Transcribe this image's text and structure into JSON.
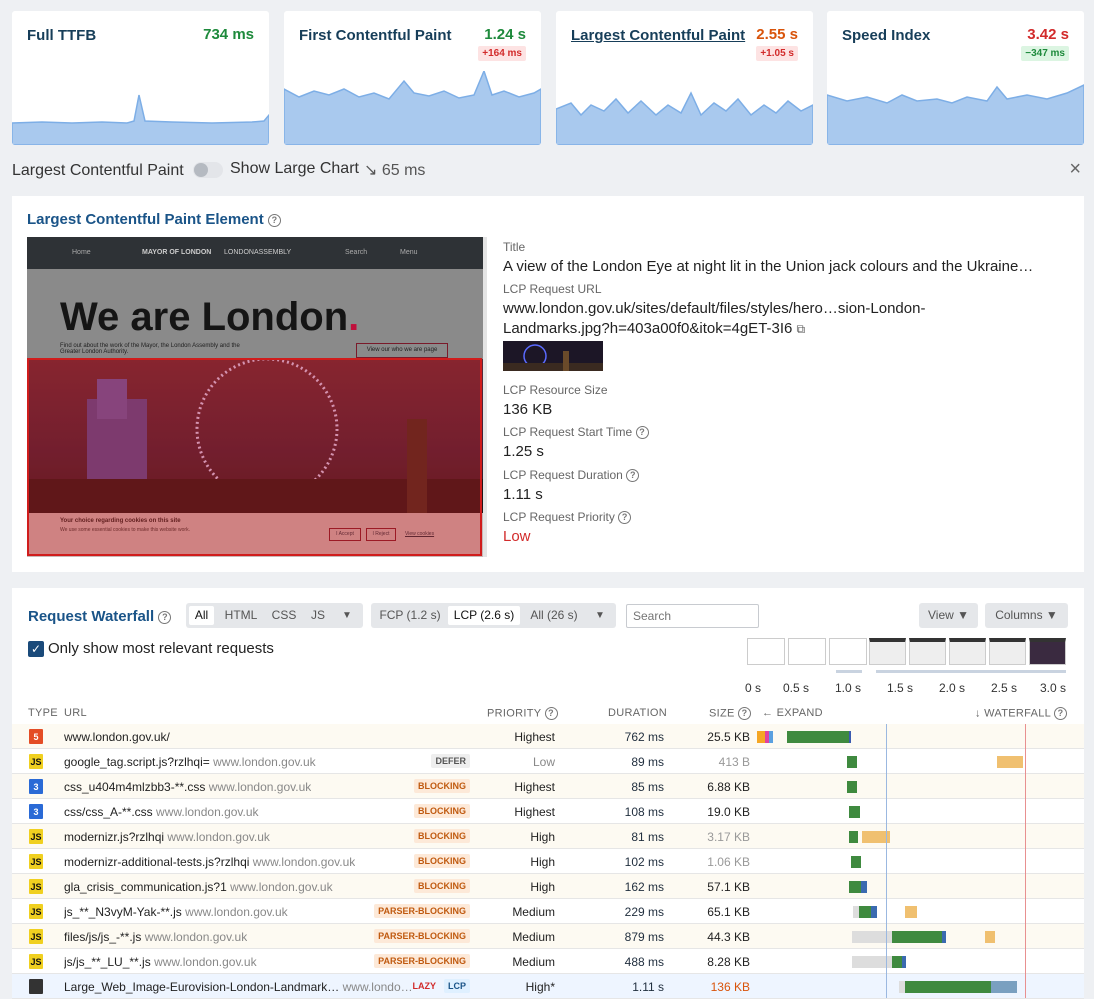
{
  "metrics": [
    {
      "name": "Full TTFB",
      "value": "734 ms",
      "value_color": "#1e8a3c",
      "delta": ""
    },
    {
      "name": "First Contentful Paint",
      "value": "1.24 s",
      "value_color": "#1e8a3c",
      "delta": "+164 ms",
      "delta_kind": "bad"
    },
    {
      "name": "Largest Contentful Paint",
      "value": "2.55 s",
      "value_color": "#d9540b",
      "delta": "+1.05 s",
      "delta_kind": "bad"
    },
    {
      "name": "Speed Index",
      "value": "3.42 s",
      "value_color": "#d22b2b",
      "delta": "−347 ms",
      "delta_kind": "good"
    }
  ],
  "chart_bar": {
    "title": "Largest Contentful Paint",
    "toggle_label": "Show Large Chart",
    "trend": "↘ 65 ms",
    "close": "×"
  },
  "lcp": {
    "heading": "Largest Contentful Paint Element",
    "screenshot": {
      "nav_home": "Home",
      "nav_brand": "MAYOR OF LONDON",
      "nav_brand2": "LONDONASSEMBLY",
      "nav_search": "Search",
      "nav_menu": "Menu",
      "hero": "We are London",
      "hero_dot": ".",
      "intro": "Find out about the work of the Mayor, the London Assembly and the Greater London Authority.",
      "cta": "View our who we are page",
      "cookie_title": "Your choice regarding cookies on this site",
      "cookie_text": "We use some essential cookies to make this website work.",
      "cookie_accept": "I Accept",
      "cookie_reject": "I Reject",
      "cookie_view": "View cookies"
    },
    "title_label": "Title",
    "title_value": "A view of the London Eye at night lit in the Union jack colours and the Ukraine…",
    "url_label": "LCP Request URL",
    "url_value1": "www.london.gov.uk/sites/default/files/styles/hero…sion-London-",
    "url_value2": "Landmarks.jpg?h=403a00f0&itok=4gET-3I6",
    "size_label": "LCP Resource Size",
    "size_value": "136 KB",
    "start_label": "LCP Request Start Time",
    "start_value": "1.25 s",
    "dur_label": "LCP Request Duration",
    "dur_value": "1.11 s",
    "prio_label": "LCP Request Priority",
    "prio_value": "Low"
  },
  "waterfall": {
    "heading": "Request Waterfall",
    "types": [
      "All",
      "HTML",
      "CSS",
      "JS"
    ],
    "ranges": [
      "FCP (1.2 s)",
      "LCP (2.6 s)",
      "All (26 s)"
    ],
    "search_placeholder": "Search",
    "view_label": "View ▼",
    "columns_label": "Columns ▼",
    "relevant_label": "Only show most relevant requests",
    "timeline_ticks": [
      "0 s",
      "0.5 s",
      "1.0 s",
      "1.5 s",
      "2.0 s",
      "2.5 s",
      "3.0 s"
    ],
    "col_type": "TYPE",
    "col_url": "URL",
    "col_priority": "PRIORITY",
    "col_duration": "DURATION",
    "col_size": "SIZE",
    "col_expand": "← EXPAND",
    "col_waterfall": "↓ WATERFALL",
    "rows": [
      {
        "type": "html",
        "url": "www.london.gov.uk/",
        "host": "",
        "tag": "",
        "priority": "Highest",
        "duration": "762 ms",
        "size": "25.5 KB",
        "size_dim": false
      },
      {
        "type": "js",
        "url": "google_tag.script.js?rzlhqi=",
        "host": "www.london.gov.uk",
        "tag": "DEFER",
        "priority": "Low",
        "duration": "89 ms",
        "size": "413 B",
        "size_dim": true
      },
      {
        "type": "css",
        "url": "css_u404m4mlzbb3-**.css",
        "host": "www.london.gov.uk",
        "tag": "BLOCKING",
        "priority": "Highest",
        "duration": "85 ms",
        "size": "6.88 KB",
        "size_dim": false
      },
      {
        "type": "css",
        "url": "css/css_A-**.css",
        "host": "www.london.gov.uk",
        "tag": "BLOCKING",
        "priority": "Highest",
        "duration": "108 ms",
        "size": "19.0 KB",
        "size_dim": false
      },
      {
        "type": "js",
        "url": "modernizr.js?rzlhqi",
        "host": "www.london.gov.uk",
        "tag": "BLOCKING",
        "priority": "High",
        "duration": "81 ms",
        "size": "3.17 KB",
        "size_dim": true
      },
      {
        "type": "js",
        "url": "modernizr-additional-tests.js?rzlhqi",
        "host": "www.london.gov.uk",
        "tag": "BLOCKING",
        "priority": "High",
        "duration": "102 ms",
        "size": "1.06 KB",
        "size_dim": true
      },
      {
        "type": "js",
        "url": "gla_crisis_communication.js?1",
        "host": "www.london.gov.uk",
        "tag": "BLOCKING",
        "priority": "High",
        "duration": "162 ms",
        "size": "57.1 KB",
        "size_dim": false
      },
      {
        "type": "js",
        "url": "js_**_N3vyM-Yak-**.js",
        "host": "www.london.gov.uk",
        "tag": "PARSER-BLOCKING",
        "priority": "Medium",
        "duration": "229 ms",
        "size": "65.1 KB",
        "size_dim": false
      },
      {
        "type": "js",
        "url": "files/js/js_-**.js",
        "host": "www.london.gov.uk",
        "tag": "PARSER-BLOCKING",
        "priority": "Medium",
        "duration": "879 ms",
        "size": "44.3 KB",
        "size_dim": false
      },
      {
        "type": "js",
        "url": "js/js_**_LU_**.js",
        "host": "www.london.gov.uk",
        "tag": "PARSER-BLOCKING",
        "priority": "Medium",
        "duration": "488 ms",
        "size": "8.28 KB",
        "size_dim": false
      },
      {
        "type": "img",
        "url": "Large_Web_Image-Eurovision-London-Landmark…",
        "host": "www.londo…",
        "tag": "LAZY",
        "tag2": "LCP",
        "priority": "High*",
        "duration": "1.11 s",
        "size": "136 KB",
        "size_dim": false,
        "size_orange": true
      }
    ]
  }
}
